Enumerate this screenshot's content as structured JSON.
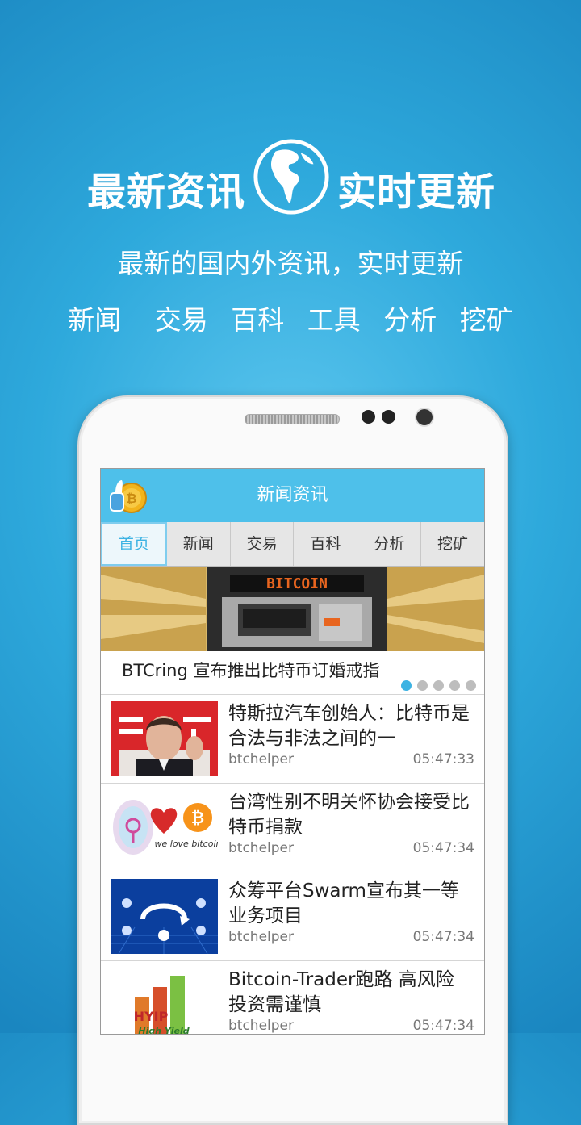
{
  "hero": {
    "title_left": "最新资讯",
    "title_right": "实时更新",
    "subtitle": "最新的国内外资讯，实时更新",
    "features": [
      "新闻",
      "交易",
      "百科",
      "工具",
      "分析",
      "挖矿"
    ]
  },
  "app": {
    "title": "新闻资讯",
    "tabs": [
      "首页",
      "新闻",
      "交易",
      "百科",
      "分析",
      "挖矿"
    ],
    "active_tab": "首页",
    "banner": {
      "sign_text": "BITCOIN",
      "caption": "BTCring 宣布推出比特币订婚戒指",
      "page_count": 5,
      "active_index": 0
    },
    "news": [
      {
        "title": "特斯拉汽车创始人：比特币是合法与非法之间的一",
        "source": "btchelper",
        "time": "05:47:33"
      },
      {
        "title": "台湾性别不明关怀协会接受比特币捐款",
        "source": "btchelper",
        "time": "05:47:34",
        "thumb_text": "we love bitcoin"
      },
      {
        "title": "众筹平台Swarm宣布其一等业务项目",
        "source": "btchelper",
        "time": "05:47:34"
      },
      {
        "title": "Bitcoin-Trader跑路 高风险投资需谨慎",
        "source": "btchelper",
        "time": "05:47:34",
        "thumb_text": "HYIP",
        "thumb_text2": "High Yield"
      }
    ]
  },
  "colors": {
    "accent": "#4ec0ea",
    "background": "#2ea9dc"
  }
}
